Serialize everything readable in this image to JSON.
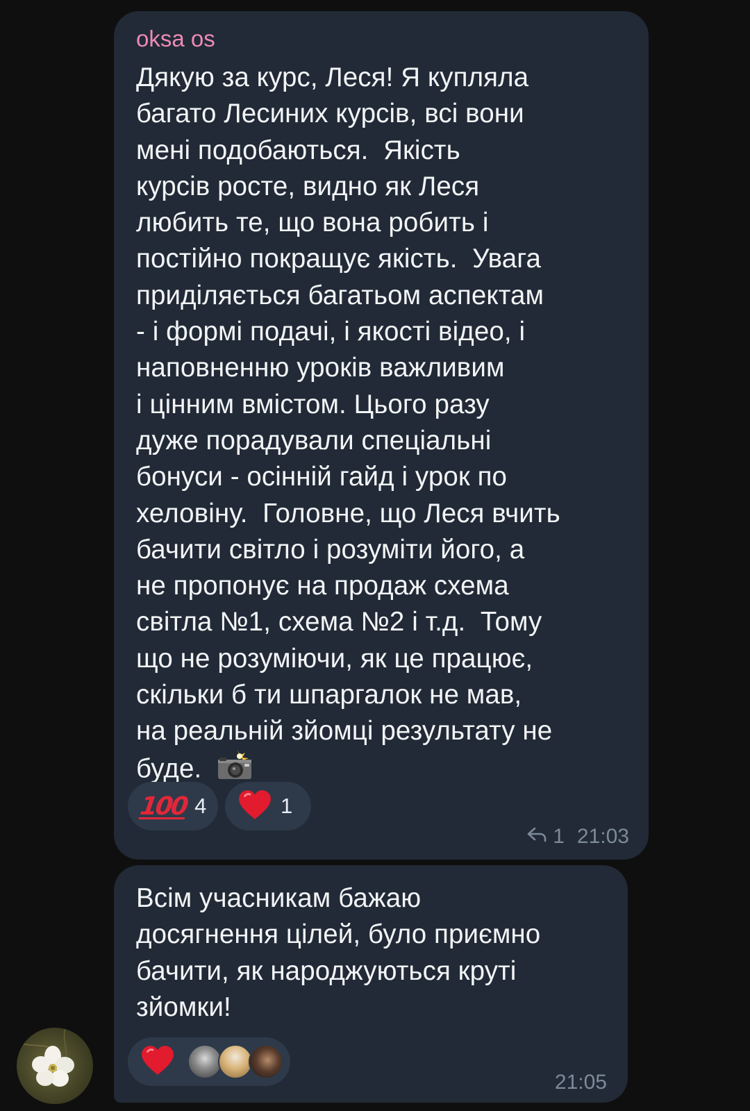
{
  "messages": [
    {
      "author": "oksa os",
      "text": "Дякую за курс, Леся! Я купляла\nбагато Лесиних курсів, всі вони\nмені подобаються.  Якість\nкурсів росте, видно як Леся\nлюбить те, що вона робить і\nпостійно покращує якість.  Увага\nприділяється багатьом аспектам\n- і формі подачі, і якості відео, і\nнаповненню уроків важливим\nі цінним вмістом. Цього разу\nдуже порадували спеціальні\nбонуси - осінній гайд і урок по\nхеловіну.  Головне, що Леся вчить\nбачити світло і розуміти його, а\nне пропонує на продаж схема\nсвітла №1, схема №2 і т.д.  Тому\nщо не розуміючи, як це працює,\nскільки б ти шпаргалок не мав,\nна реальній зйомці результату не\nбуде.",
      "text_emoji": "camera-flash-icon",
      "reactions": [
        {
          "emoji": "hundred-points-icon",
          "glyph": "100",
          "count": "4"
        },
        {
          "emoji": "red-heart-icon",
          "count": "1"
        }
      ],
      "reply_count": "1",
      "time": "21:03"
    },
    {
      "text": "Всім учасникам бажаю\nдосягнення цілей, було приємно\nбачити, як народжуються круті\nзйомки!",
      "reactions": [
        {
          "emoji": "red-heart-icon",
          "avatars": [
            "reactor-avatar-1",
            "reactor-avatar-2",
            "reactor-avatar-3"
          ]
        }
      ],
      "time": "21:05"
    }
  ],
  "colors": {
    "background": "#0f0f0f",
    "bubble": "#212a36",
    "reaction_pill": "#2e3a4a",
    "author_name": "#ec8ab6",
    "meta_text": "#7d8a99",
    "heart": "#e21b2e"
  }
}
